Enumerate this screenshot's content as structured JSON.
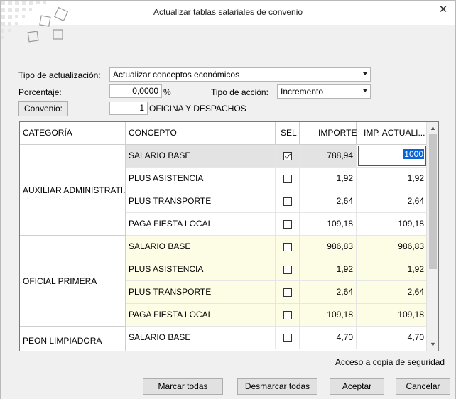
{
  "window": {
    "title": "Actualizar tablas salariales de convenio"
  },
  "form": {
    "tipo_label": "Tipo de actualización:",
    "tipo_value": "Actualizar conceptos económicos",
    "porcentaje_label": "Porcentaje:",
    "porcentaje_value": "0,0000",
    "porcentaje_unit": "%",
    "accion_label": "Tipo de acción:",
    "accion_value": "Incremento",
    "convenio_button": "Convenio:",
    "convenio_code": "1",
    "convenio_name": "OFICINA Y DESPACHOS"
  },
  "grid": {
    "headers": {
      "categoria": "CATEGORÍA",
      "concepto": "CONCEPTO",
      "sel": "SEL",
      "importe": "IMPORTE",
      "imp_act": "IMP. ACTUALI..."
    },
    "groups": [
      {
        "categoria": "AUXILIAR ADMINISTRATI...",
        "color": "#ffffff",
        "rows": [
          {
            "concepto": "SALARIO BASE",
            "sel": true,
            "importe": "788,94",
            "actualizado": "1000"
          },
          {
            "concepto": "PLUS ASISTENCIA",
            "sel": false,
            "importe": "1,92",
            "actualizado": "1,92"
          },
          {
            "concepto": "PLUS TRANSPORTE",
            "sel": false,
            "importe": "2,64",
            "actualizado": "2,64"
          },
          {
            "concepto": "PAGA FIESTA LOCAL",
            "sel": false,
            "importe": "109,18",
            "actualizado": "109,18"
          }
        ]
      },
      {
        "categoria": "OFICIAL PRIMERA",
        "color": "#fdfde6",
        "rows": [
          {
            "concepto": "SALARIO BASE",
            "sel": false,
            "importe": "986,83",
            "actualizado": "986,83"
          },
          {
            "concepto": "PLUS ASISTENCIA",
            "sel": false,
            "importe": "1,92",
            "actualizado": "1,92"
          },
          {
            "concepto": "PLUS TRANSPORTE",
            "sel": false,
            "importe": "2,64",
            "actualizado": "2,64"
          },
          {
            "concepto": "PAGA FIESTA LOCAL",
            "sel": false,
            "importe": "109,18",
            "actualizado": "109,18"
          }
        ]
      },
      {
        "categoria": "PEON LIMPIADORA",
        "color": "#ffffff",
        "rows": [
          {
            "concepto": "SALARIO BASE",
            "sel": false,
            "importe": "4,70",
            "actualizado": "4,70"
          }
        ]
      }
    ]
  },
  "backup_link": "Acceso a copia de seguridad",
  "buttons": {
    "marcar": "Marcar todas",
    "desmarcar": "Desmarcar todas",
    "aceptar": "Aceptar",
    "cancelar": "Cancelar"
  },
  "icons": {
    "close": "close-icon",
    "logo": "squares-logo-icon"
  }
}
